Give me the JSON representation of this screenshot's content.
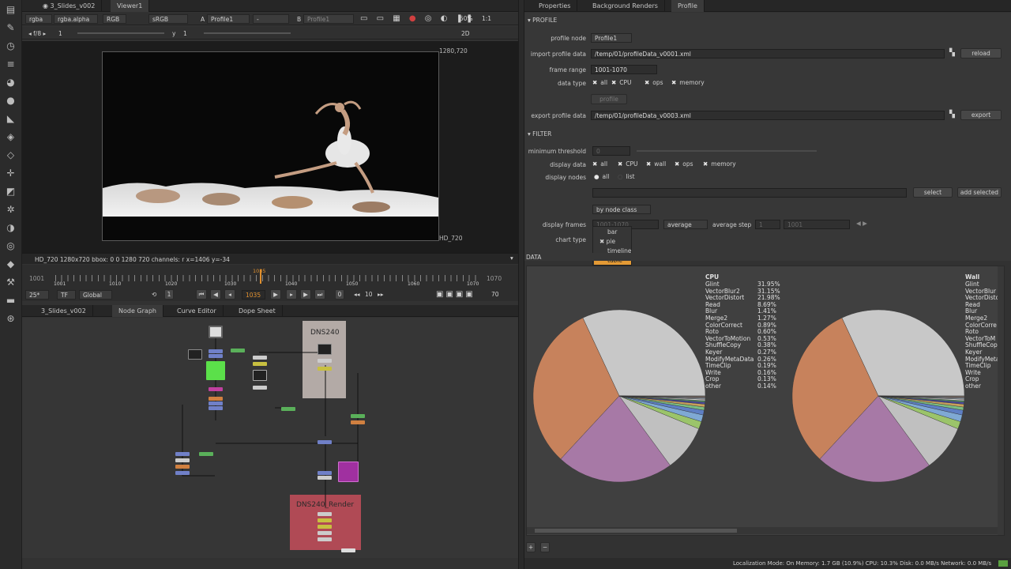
{
  "left_toolbar": {
    "icons": [
      "viewer-icon",
      "paint-icon",
      "time-icon",
      "channel-icon",
      "color-icon",
      "filter-icon",
      "draw-icon",
      "stack-icon",
      "merge-icon",
      "transform-icon",
      "3d-icon",
      "particles-icon",
      "deep-icon",
      "views-icon",
      "metadata-icon",
      "toolsets-icon",
      "other-icon",
      "gizmo-icon"
    ]
  },
  "viewer_tabs": [
    {
      "label": "3_Slides_v002"
    },
    {
      "label": "Viewer1"
    }
  ],
  "viewer_toolbar": {
    "channels": "rgba",
    "alpha": "rgba.alpha",
    "colorspace_rgb": "RGB",
    "lut": "sRGB",
    "input_a_label": "A",
    "input_a": "Profile1",
    "input_b_placeholder": "-",
    "input_b_label": "B",
    "input_b": "Profile1",
    "zoom": "50%",
    "ratio": "1:1"
  },
  "viewer_toolbar2": {
    "fstop": "f/8",
    "gain": "1",
    "gamma_label": "y",
    "gamma": "1",
    "mode": "2D"
  },
  "viewer": {
    "format_tr": "1280,720",
    "format_br": "HD_720",
    "info": "HD_720 1280x720  bbox: 0 0 1280 720 channels: r  x=1406 y=-34"
  },
  "timeline": {
    "start": "1001",
    "end": "1070",
    "current": "1035",
    "ticks": [
      "1001",
      "1010",
      "1020",
      "1030",
      "1040",
      "1050",
      "1060",
      "1070"
    ],
    "fps": "25*",
    "tf": "TF",
    "scope": "Global",
    "frame": "1035",
    "step": "10",
    "end_frame": "70",
    "increment": "1",
    "zero": "0"
  },
  "nodegraph_tabs": [
    {
      "label": "3_Slides_v002"
    },
    {
      "label": "Node Graph"
    },
    {
      "label": "Curve Editor"
    },
    {
      "label": "Dope Sheet"
    }
  ],
  "nodegraph": {
    "backdrop1": "DNS240",
    "backdrop2": "DNS240_Render"
  },
  "right_tabs": [
    {
      "label": "Properties"
    },
    {
      "label": "Background Renders"
    },
    {
      "label": "Profile"
    }
  ],
  "profile": {
    "section_profile": "PROFILE",
    "profile_node_label": "profile node",
    "profile_node": "Profile1",
    "import_label": "import profile data",
    "import_path": "/temp/01/profileData_v0001.xml",
    "reload": "reload",
    "frame_range_label": "frame range",
    "frame_range": "1001-1070",
    "data_type_label": "data type",
    "data_type_opts": [
      "all",
      "CPU",
      "ops",
      "memory"
    ],
    "profile_btn": "profile",
    "export_label": "export profile data",
    "export_path": "/temp/01/profileData_v0003.xml",
    "export": "export",
    "section_filter": "FILTER",
    "min_threshold_label": "minimum threshold",
    "min_threshold": "0",
    "display_data_label": "display data",
    "display_data_opts": [
      "all",
      "CPU",
      "wall",
      "ops",
      "memory"
    ],
    "display_nodes_label": "display nodes",
    "display_nodes_opts": [
      "all",
      "list"
    ],
    "select": "select",
    "add_selected": "add selected",
    "by_node_class": "by node class",
    "display_frames_label": "display frames",
    "display_frames": "1001-1070",
    "average": "average",
    "average_step_label": "average step",
    "average_step": "1",
    "frame_val": "1001",
    "chart_type_label": "chart type",
    "chart_menu": [
      "bar",
      "pie",
      "timeline",
      "table"
    ],
    "section_data": "DATA"
  },
  "pie1": {
    "title": "CPU",
    "names": [
      "Glint",
      "VectorBlur2",
      "VectorDistort",
      "Read",
      "Blur",
      "Merge2",
      "ColorCorrect",
      "Roto",
      "VectorToMotion",
      "ShuffleCopy",
      "Keyer",
      "ModifyMetaData",
      "TimeClip",
      "Write",
      "Crop",
      "other"
    ],
    "values": [
      "31.95%",
      "31.15%",
      "21.98%",
      "8.69%",
      "1.41%",
      "1.27%",
      "0.89%",
      "0.60%",
      "0.53%",
      "0.38%",
      "0.27%",
      "0.26%",
      "0.19%",
      "0.16%",
      "0.13%",
      "0.14%"
    ]
  },
  "pie2": {
    "title": "Wall",
    "names": [
      "Glint",
      "VectorBlur",
      "VectorDisto",
      "Read",
      "Blur",
      "Merge2",
      "ColorCorre",
      "Roto",
      "VectorToM",
      "ShuffleCop",
      "Keyer",
      "ModifyMeta",
      "TimeClip",
      "Write",
      "Crop",
      "other"
    ]
  },
  "chart_data": {
    "type": "pie",
    "title": "CPU",
    "categories": [
      "Glint",
      "VectorBlur2",
      "VectorDistort",
      "Read",
      "Blur",
      "Merge2",
      "ColorCorrect",
      "Roto",
      "VectorToMotion",
      "ShuffleCopy",
      "Keyer",
      "ModifyMetaData",
      "TimeClip",
      "Write",
      "Crop",
      "other"
    ],
    "values": [
      31.95,
      31.15,
      21.98,
      8.69,
      1.41,
      1.27,
      0.89,
      0.6,
      0.53,
      0.38,
      0.27,
      0.26,
      0.19,
      0.16,
      0.13,
      0.14
    ],
    "colors": [
      "#c8c8c8",
      "#c7825c",
      "#a779a6",
      "#c0c0c0",
      "#9bc46a",
      "#7fa9d4",
      "#5e7fc4",
      "#7bbd82",
      "#c9a05c",
      "#4a4a9c",
      "#5a9a6a",
      "#d0d0d0",
      "#a0a0a0",
      "#88aacc",
      "#c77a50",
      "#999999"
    ]
  },
  "status": {
    "text": "Localization Mode: On  Memory: 1.7 GB (10.9%) CPU: 10.3% Disk: 0.0 MB/s Network: 0.0 MB/s"
  },
  "bottom_buttons": {
    "plus": "+",
    "minus": "−"
  }
}
